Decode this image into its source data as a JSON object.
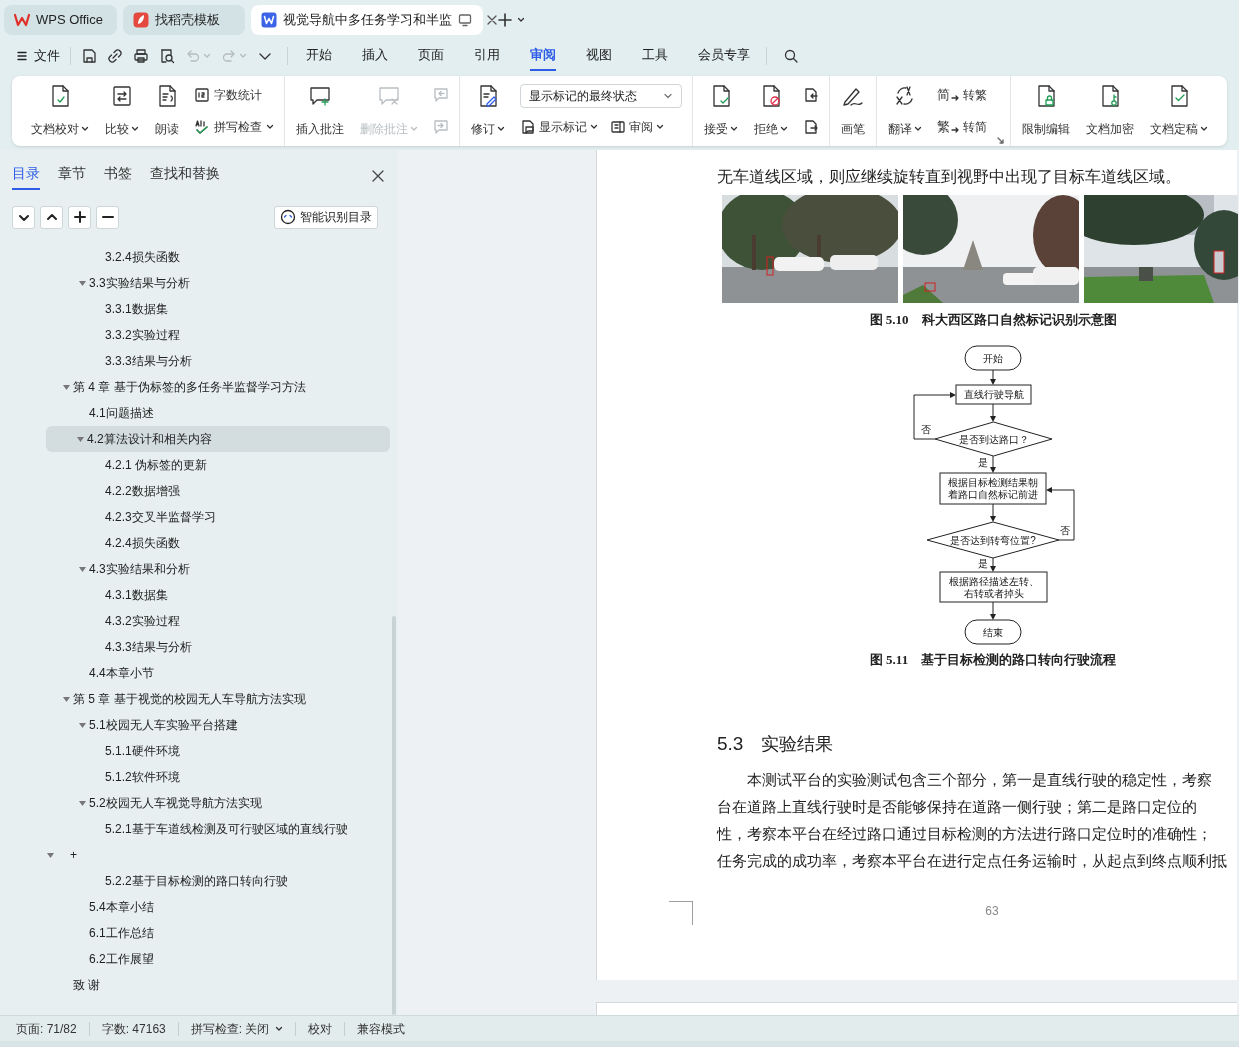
{
  "app_tabs": [
    {
      "label": "WPS Office",
      "kind": "home",
      "selected": false
    },
    {
      "label": "找稻壳模板",
      "kind": "template",
      "selected": false
    },
    {
      "label": "视觉导航中多任务学习和半监",
      "kind": "document",
      "selected": true
    }
  ],
  "menu": {
    "file": "文件",
    "quick_access": [
      {
        "disabled": false
      },
      {
        "disabled": false
      },
      {
        "disabled": false
      },
      {
        "disabled": false
      },
      {
        "disabled": true
      },
      {
        "disabled": true
      },
      {
        "disabled": false
      }
    ],
    "tabs": [
      {
        "label": "开始",
        "selected": false
      },
      {
        "label": "插入",
        "selected": false
      },
      {
        "label": "页面",
        "selected": false
      },
      {
        "label": "引用",
        "selected": false
      },
      {
        "label": "审阅",
        "selected": true
      },
      {
        "label": "视图",
        "selected": false
      },
      {
        "label": "工具",
        "selected": false
      },
      {
        "label": "会员专享",
        "selected": false
      }
    ]
  },
  "ribbon": {
    "groups": [
      {
        "items": [
          {
            "kind": "large",
            "label": "文档校对",
            "caret": true,
            "disabled": false
          },
          {
            "kind": "large",
            "label": "比较",
            "caret": true,
            "disabled": false
          },
          {
            "kind": "large",
            "label": "朗读",
            "caret": false,
            "disabled": false
          },
          {
            "kind": "stack",
            "items": [
              {
                "kind": "button",
                "label": "字数统计",
                "caret": false,
                "disabled": false
              },
              {
                "kind": "button",
                "label": "拼写检查",
                "caret": true,
                "disabled": false
              }
            ]
          }
        ]
      },
      {
        "items": [
          {
            "kind": "large",
            "label": "插入批注",
            "caret": false,
            "disabled": false
          },
          {
            "kind": "large",
            "label": "删除批注",
            "caret": true,
            "disabled": true
          },
          {
            "kind": "stack",
            "items": [
              {
                "kind": "button",
                "caret": false,
                "disabled": true
              },
              {
                "kind": "button",
                "caret": false,
                "disabled": true
              }
            ]
          }
        ]
      },
      {
        "items": [
          {
            "kind": "large",
            "label": "修订",
            "caret": true,
            "disabled": false
          },
          {
            "kind": "stack",
            "items": [
              {
                "kind": "select",
                "value": "显示标记的最终状态"
              },
              {
                "kind": "pair",
                "items": [
                  {
                    "kind": "button",
                    "label": "显示标记",
                    "caret": true,
                    "disabled": false
                  },
                  {
                    "kind": "button",
                    "label": "审阅",
                    "caret": true,
                    "disabled": false
                  }
                ]
              }
            ]
          }
        ]
      },
      {
        "items": [
          {
            "kind": "large",
            "label": "接受",
            "caret": true,
            "disabled": false
          },
          {
            "kind": "large",
            "label": "拒绝",
            "caret": true,
            "disabled": false
          },
          {
            "kind": "stack",
            "items": [
              {
                "kind": "button",
                "caret": false,
                "disabled": false
              },
              {
                "kind": "button",
                "caret": false,
                "disabled": false
              }
            ]
          }
        ]
      },
      {
        "items": [
          {
            "kind": "large",
            "label": "画笔",
            "caret": false,
            "disabled": false
          }
        ]
      },
      {
        "items": [
          {
            "kind": "large",
            "label": "翻译",
            "caret": true,
            "disabled": false
          },
          {
            "kind": "stack",
            "items": [
              {
                "kind": "button",
                "glyph": "简",
                "label": "转繁",
                "caret": false,
                "disabled": false
              },
              {
                "kind": "button",
                "glyph": "繁",
                "label": "转简",
                "caret": false,
                "disabled": false
              }
            ]
          }
        ]
      },
      {
        "items": [
          {
            "kind": "large",
            "label": "限制编辑",
            "caret": false,
            "disabled": false
          },
          {
            "kind": "large",
            "label": "文档加密",
            "caret": false,
            "disabled": false
          },
          {
            "kind": "large",
            "label": "文档定稿",
            "caret": true,
            "disabled": false
          }
        ]
      }
    ]
  },
  "sidebar": {
    "tabs": [
      {
        "label": "目录",
        "selected": true
      },
      {
        "label": "章节",
        "selected": false
      },
      {
        "label": "书签",
        "selected": false
      },
      {
        "label": "查找和替换",
        "selected": false
      }
    ],
    "smart_button": "智能识别目录",
    "toc": [
      {
        "children": [
          {
            "children": [
              {
                "children": [
                  {
                    "label": "3.2.4损失函数",
                    "selected": false
                  }
                ]
              },
              {
                "label": "3.3实验结果与分析",
                "selected": false,
                "expanded": true,
                "children": [
                  {
                    "label": "3.3.1数据集",
                    "selected": false
                  },
                  {
                    "label": "3.3.2实验过程",
                    "selected": false
                  },
                  {
                    "label": "3.3.3结果与分析",
                    "selected": false
                  }
                ]
              }
            ]
          },
          {
            "label": "第 4 章  基于伪标签的多任务半监督学习方法",
            "selected": false,
            "expanded": true,
            "children": [
              {
                "label": "4.1问题描述",
                "selected": false
              },
              {
                "label": "4.2算法设计和相关内容",
                "selected": true,
                "expanded": true,
                "children": [
                  {
                    "label": "4.2.1  伪标签的更新",
                    "selected": false
                  },
                  {
                    "label": "4.2.2数据增强",
                    "selected": false
                  },
                  {
                    "label": "4.2.3交叉半监督学习",
                    "selected": false
                  },
                  {
                    "label": "4.2.4损失函数",
                    "selected": false
                  }
                ]
              },
              {
                "label": "4.3实验结果和分析",
                "selected": false,
                "expanded": true,
                "children": [
                  {
                    "label": "4.3.1数据集",
                    "selected": false
                  },
                  {
                    "label": "4.3.2实验过程",
                    "selected": false
                  },
                  {
                    "label": "4.3.3结果与分析",
                    "selected": false
                  }
                ]
              },
              {
                "label": "4.4本章小节",
                "selected": false
              }
            ]
          },
          {
            "label": "第 5 章  基于视觉的校园无人车导航方法实现",
            "selected": false,
            "expanded": true,
            "children": [
              {
                "label": "5.1校园无人车实验平台搭建",
                "selected": false,
                "expanded": true,
                "children": [
                  {
                    "label": "5.1.1硬件环境",
                    "selected": false
                  },
                  {
                    "label": "5.1.2软件环境",
                    "selected": false
                  }
                ]
              },
              {
                "label": "5.2校园无人车视觉导航方法实现",
                "selected": false,
                "expanded": true,
                "children": [
                  {
                    "label": "5.2.1基于车道线检测及可行驶区域的直线行驶",
                    "selected": false
                  }
                ]
              }
            ]
          }
        ]
      },
      {
        "label": "+",
        "selected": false,
        "expanded": true,
        "children": [
          {
            "children": [
              {
                "children": [
                  {
                    "label": "5.2.2基于目标检测的路口转向行驶",
                    "selected": false
                  }
                ]
              },
              {
                "label": "5.4本章小结",
                "selected": false
              },
              {
                "label": "6.1工作总结",
                "selected": false
              },
              {
                "label": "6.2工作展望",
                "selected": false
              }
            ]
          },
          {
            "label": "致 谢",
            "selected": false
          }
        ]
      }
    ]
  },
  "document": {
    "lines": [
      "无车道线区域，则应继续旋转直到视野中出现了目标车道线区域。"
    ],
    "photos": [
      {
        "kind": "picture"
      },
      {
        "kind": "picture"
      },
      {
        "kind": "picture"
      }
    ],
    "figure_caption": "图 5.10    科大西区路口自然标记识别示意图",
    "flowchart": {
      "nodes": [
        {
          "kind": "terminal",
          "lines": [
            "开始"
          ]
        },
        {
          "kind": "process",
          "lines": [
            "直线行驶导航"
          ]
        },
        {
          "kind": "decision",
          "lines": [
            "是否到达路口？"
          ]
        },
        {
          "kind": "process",
          "lines": [
            "根据目标检测结果朝",
            "着路口自然标记前进"
          ]
        },
        {
          "kind": "decision",
          "lines": [
            "是否达到转弯位置?"
          ]
        },
        {
          "kind": "process",
          "lines": [
            "根据路径描述左转、",
            "右转或者掉头"
          ]
        },
        {
          "kind": "terminal",
          "lines": [
            "结束"
          ]
        }
      ],
      "edges": [
        {
          "kind": "straight"
        },
        {
          "kind": "straight"
        },
        {
          "kind": "straight",
          "label": "是"
        },
        {
          "kind": "straight"
        },
        {
          "kind": "straight",
          "label": "是"
        },
        {
          "kind": "straight"
        },
        {
          "kind": "loop",
          "label": "否"
        },
        {
          "kind": "loop",
          "label": "否"
        }
      ]
    },
    "flowchart_caption": "图 5.11    基于目标检测的路口转向行驶流程",
    "heading": {
      "number": "5.3",
      "title": "实验结果"
    },
    "paragraph_lines": [
      "本测试平台的实验测试包含三个部分，第一是直线行驶的稳定性，考察",
      "台在道路上直线行驶时是否能够保持在道路一侧行驶；第二是路口定位的",
      "性，考察本平台在经过路口通过目标检测的方法进行路口定位时的准确性；",
      "任务完成的成功率，考察本平台在进行定点任务运输时，从起点到终点顺利抵"
    ],
    "page_number": "63"
  },
  "status_bar": [
    {
      "label": "页面: 71/82",
      "caret": false
    },
    {
      "label": "字数: 47163",
      "caret": false
    },
    {
      "label": "拼写检查: 关闭",
      "caret": true
    },
    {
      "label": "校对",
      "caret": false
    },
    {
      "label": "兼容模式",
      "caret": false
    }
  ]
}
